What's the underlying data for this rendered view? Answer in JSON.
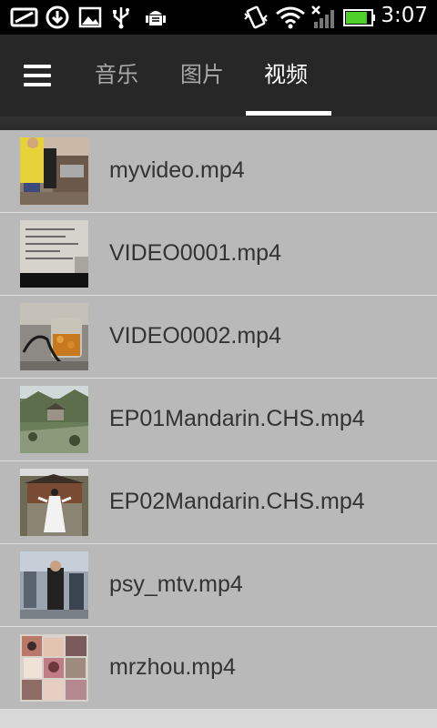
{
  "status_bar": {
    "time": "3:07",
    "icons": [
      "mail-sync-icon",
      "download-icon",
      "image-icon",
      "usb-icon",
      "android-debug-icon",
      "vibrate-icon",
      "wifi-icon",
      "signal-icon",
      "battery-icon"
    ],
    "battery_level": 0.85
  },
  "tabs": [
    {
      "label": "音乐"
    },
    {
      "label": "图片"
    },
    {
      "label": "视频"
    }
  ],
  "active_tab": "视频",
  "videos": [
    {
      "name": "myvideo.mp4",
      "thumb": "people-car-thumbnail"
    },
    {
      "name": "VIDEO0001.mp4",
      "thumb": "screen-thumbnail"
    },
    {
      "name": "VIDEO0002.mp4",
      "thumb": "jar-thumbnail"
    },
    {
      "name": "EP01Mandarin.CHS.mp4",
      "thumb": "mountain-temple-thumbnail"
    },
    {
      "name": "EP02Mandarin.CHS.mp4",
      "thumb": "palace-figure-thumbnail"
    },
    {
      "name": "psy_mtv.mp4",
      "thumb": "crowd-thumbnail"
    },
    {
      "name": "mrzhou.mp4",
      "thumb": "collage-thumbnail"
    }
  ]
}
